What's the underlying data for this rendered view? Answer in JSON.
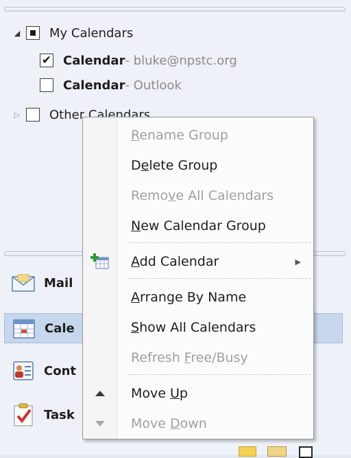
{
  "tree": {
    "my_calendars_label": "My Calendars",
    "items": [
      {
        "name": "Calendar",
        "source": " - bluke@npstc.org",
        "checked": true
      },
      {
        "name": "Calendar",
        "source": " - Outlook",
        "checked": false
      }
    ],
    "other_calendars_label": "Other Calendars"
  },
  "nav": {
    "mail": "Mail",
    "calendar": "Cale",
    "contacts": "Cont",
    "tasks": "Task"
  },
  "menu": {
    "rename_group": {
      "pre": "",
      "key": "R",
      "post": "ename Group"
    },
    "delete_group": {
      "pre": "D",
      "key": "e",
      "post": "lete Group"
    },
    "remove_all": {
      "pre": "Remo",
      "key": "v",
      "post": "e All Calendars"
    },
    "new_group": {
      "pre": "",
      "key": "N",
      "post": "ew Calendar Group"
    },
    "add_calendar": {
      "pre": "",
      "key": "A",
      "post": "dd Calendar"
    },
    "arrange_by_name": {
      "pre": "",
      "key": "A",
      "post": "rrange By Name"
    },
    "show_all": {
      "pre": "",
      "key": "S",
      "post": "how All Calendars"
    },
    "refresh": {
      "pre": "Refresh ",
      "key": "F",
      "post": "ree/Busy"
    },
    "move_up": {
      "pre": "Move ",
      "key": "U",
      "post": "p"
    },
    "move_down": {
      "pre": "Move ",
      "key": "D",
      "post": "own"
    }
  },
  "colors": {
    "accent": "#c6d6ec",
    "disabled": "#a0a0a0",
    "source_gray": "#8b8b8b"
  },
  "icons": [
    "checkmark-icon",
    "expand-arrow-icon",
    "mail-icon",
    "calendar-icon",
    "contacts-icon",
    "tasks-icon",
    "add-calendar-icon",
    "move-up-icon",
    "move-down-icon",
    "submenu-arrow-icon"
  ]
}
